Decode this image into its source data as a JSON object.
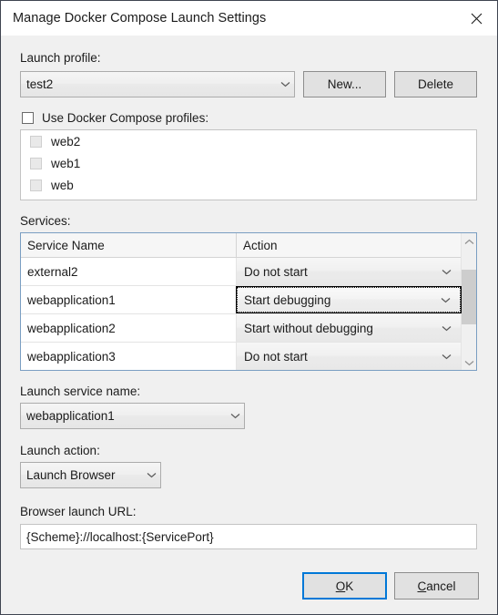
{
  "window": {
    "title": "Manage Docker Compose Launch Settings",
    "close_icon": "close-icon"
  },
  "launch_profile": {
    "label": "Launch profile:",
    "value": "test2",
    "new_button": "New...",
    "new_button_accel": "N",
    "delete_button": "Delete",
    "delete_button_accel": "D"
  },
  "compose_profiles": {
    "checkbox_label": "Use Docker Compose profiles:",
    "checked": false,
    "items": [
      {
        "label": "web2",
        "checked": false,
        "disabled": true
      },
      {
        "label": "web1",
        "checked": false,
        "disabled": true
      },
      {
        "label": "web",
        "checked": false,
        "disabled": true
      }
    ]
  },
  "services": {
    "label": "Services:",
    "columns": [
      "Service Name",
      "Action"
    ],
    "rows": [
      {
        "name": "external2",
        "action": "Do not start",
        "focused": false
      },
      {
        "name": "webapplication1",
        "action": "Start debugging",
        "focused": true
      },
      {
        "name": "webapplication2",
        "action": "Start without debugging",
        "focused": false
      },
      {
        "name": "webapplication3",
        "action": "Do not start",
        "focused": false
      }
    ],
    "scrollbar": {
      "up_icon": "chevron-up-icon",
      "down_icon": "chevron-down-icon"
    }
  },
  "launch_service_name": {
    "label": "Launch service name:",
    "value": "webapplication1"
  },
  "launch_action": {
    "label": "Launch action:",
    "value": "Launch Browser"
  },
  "browser_launch_url": {
    "label": "Browser launch URL:",
    "value": "{Scheme}://localhost:{ServicePort}"
  },
  "footer": {
    "ok_label_pre": "",
    "ok_accel": "O",
    "ok_label_post": "K",
    "cancel_accel": "C",
    "cancel_label_post": "ancel"
  },
  "colors": {
    "dialog_bg": "#f0f0f0",
    "titlebar_bg": "#ffffff",
    "accent_focus": "#0078d7",
    "grid_border": "#7a9ec2",
    "text": "#1b1b1b"
  }
}
